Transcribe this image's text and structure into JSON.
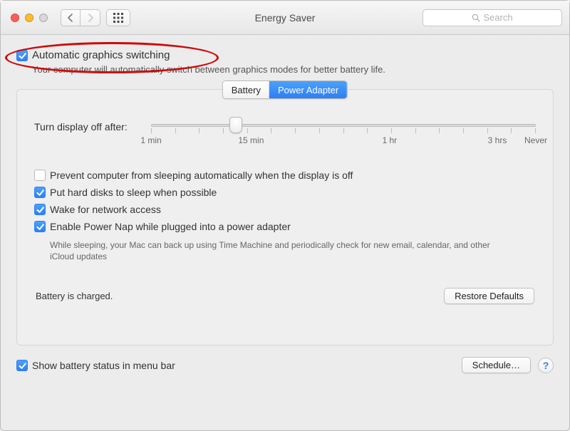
{
  "window": {
    "title": "Energy Saver"
  },
  "search": {
    "placeholder": "Search"
  },
  "auto_graphics": {
    "label": "Automatic graphics switching",
    "checked": true,
    "sub": "Your computer will automatically switch between graphics modes for better battery life."
  },
  "tabs": {
    "battery": "Battery",
    "power_adapter": "Power Adapter",
    "active": "power_adapter"
  },
  "slider": {
    "label": "Turn display off after:",
    "ticks": [
      "1 min",
      "15 min",
      "1 hr",
      "3 hrs",
      "Never"
    ]
  },
  "options": [
    {
      "label": "Prevent computer from sleeping automatically when the display is off",
      "checked": false
    },
    {
      "label": "Put hard disks to sleep when possible",
      "checked": true
    },
    {
      "label": "Wake for network access",
      "checked": true
    },
    {
      "label": "Enable Power Nap while plugged into a power adapter",
      "checked": true
    }
  ],
  "powernap_expl": "While sleeping, your Mac can back up using Time Machine and periodically check for new email, calendar, and other iCloud updates",
  "status": "Battery is charged.",
  "buttons": {
    "restore": "Restore Defaults",
    "schedule": "Schedule…"
  },
  "menubar": {
    "label": "Show battery status in menu bar",
    "checked": true
  },
  "colors": {
    "accent": "#3784f7"
  }
}
